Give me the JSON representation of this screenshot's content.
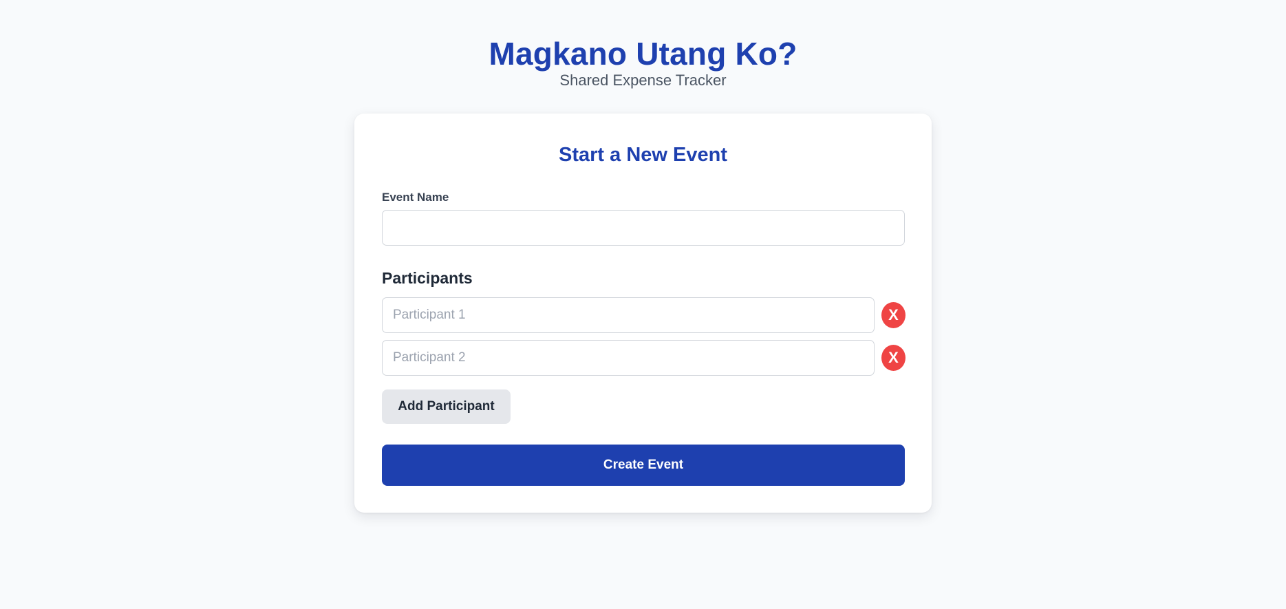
{
  "header": {
    "title": "Magkano Utang Ko?",
    "subtitle": "Shared Expense Tracker"
  },
  "form": {
    "heading": "Start a New Event",
    "event_name": {
      "label": "Event Name",
      "value": "",
      "placeholder": ""
    },
    "participants_heading": "Participants",
    "participants": [
      {
        "value": "",
        "placeholder": "Participant 1",
        "remove_label": "X"
      },
      {
        "value": "",
        "placeholder": "Participant 2",
        "remove_label": "X"
      }
    ],
    "add_participant_label": "Add Participant",
    "create_event_label": "Create Event"
  },
  "colors": {
    "background": "#f8fafc",
    "brand": "#1e40af",
    "danger": "#ef4444",
    "secondary_button": "#e5e7eb",
    "card": "#ffffff"
  }
}
